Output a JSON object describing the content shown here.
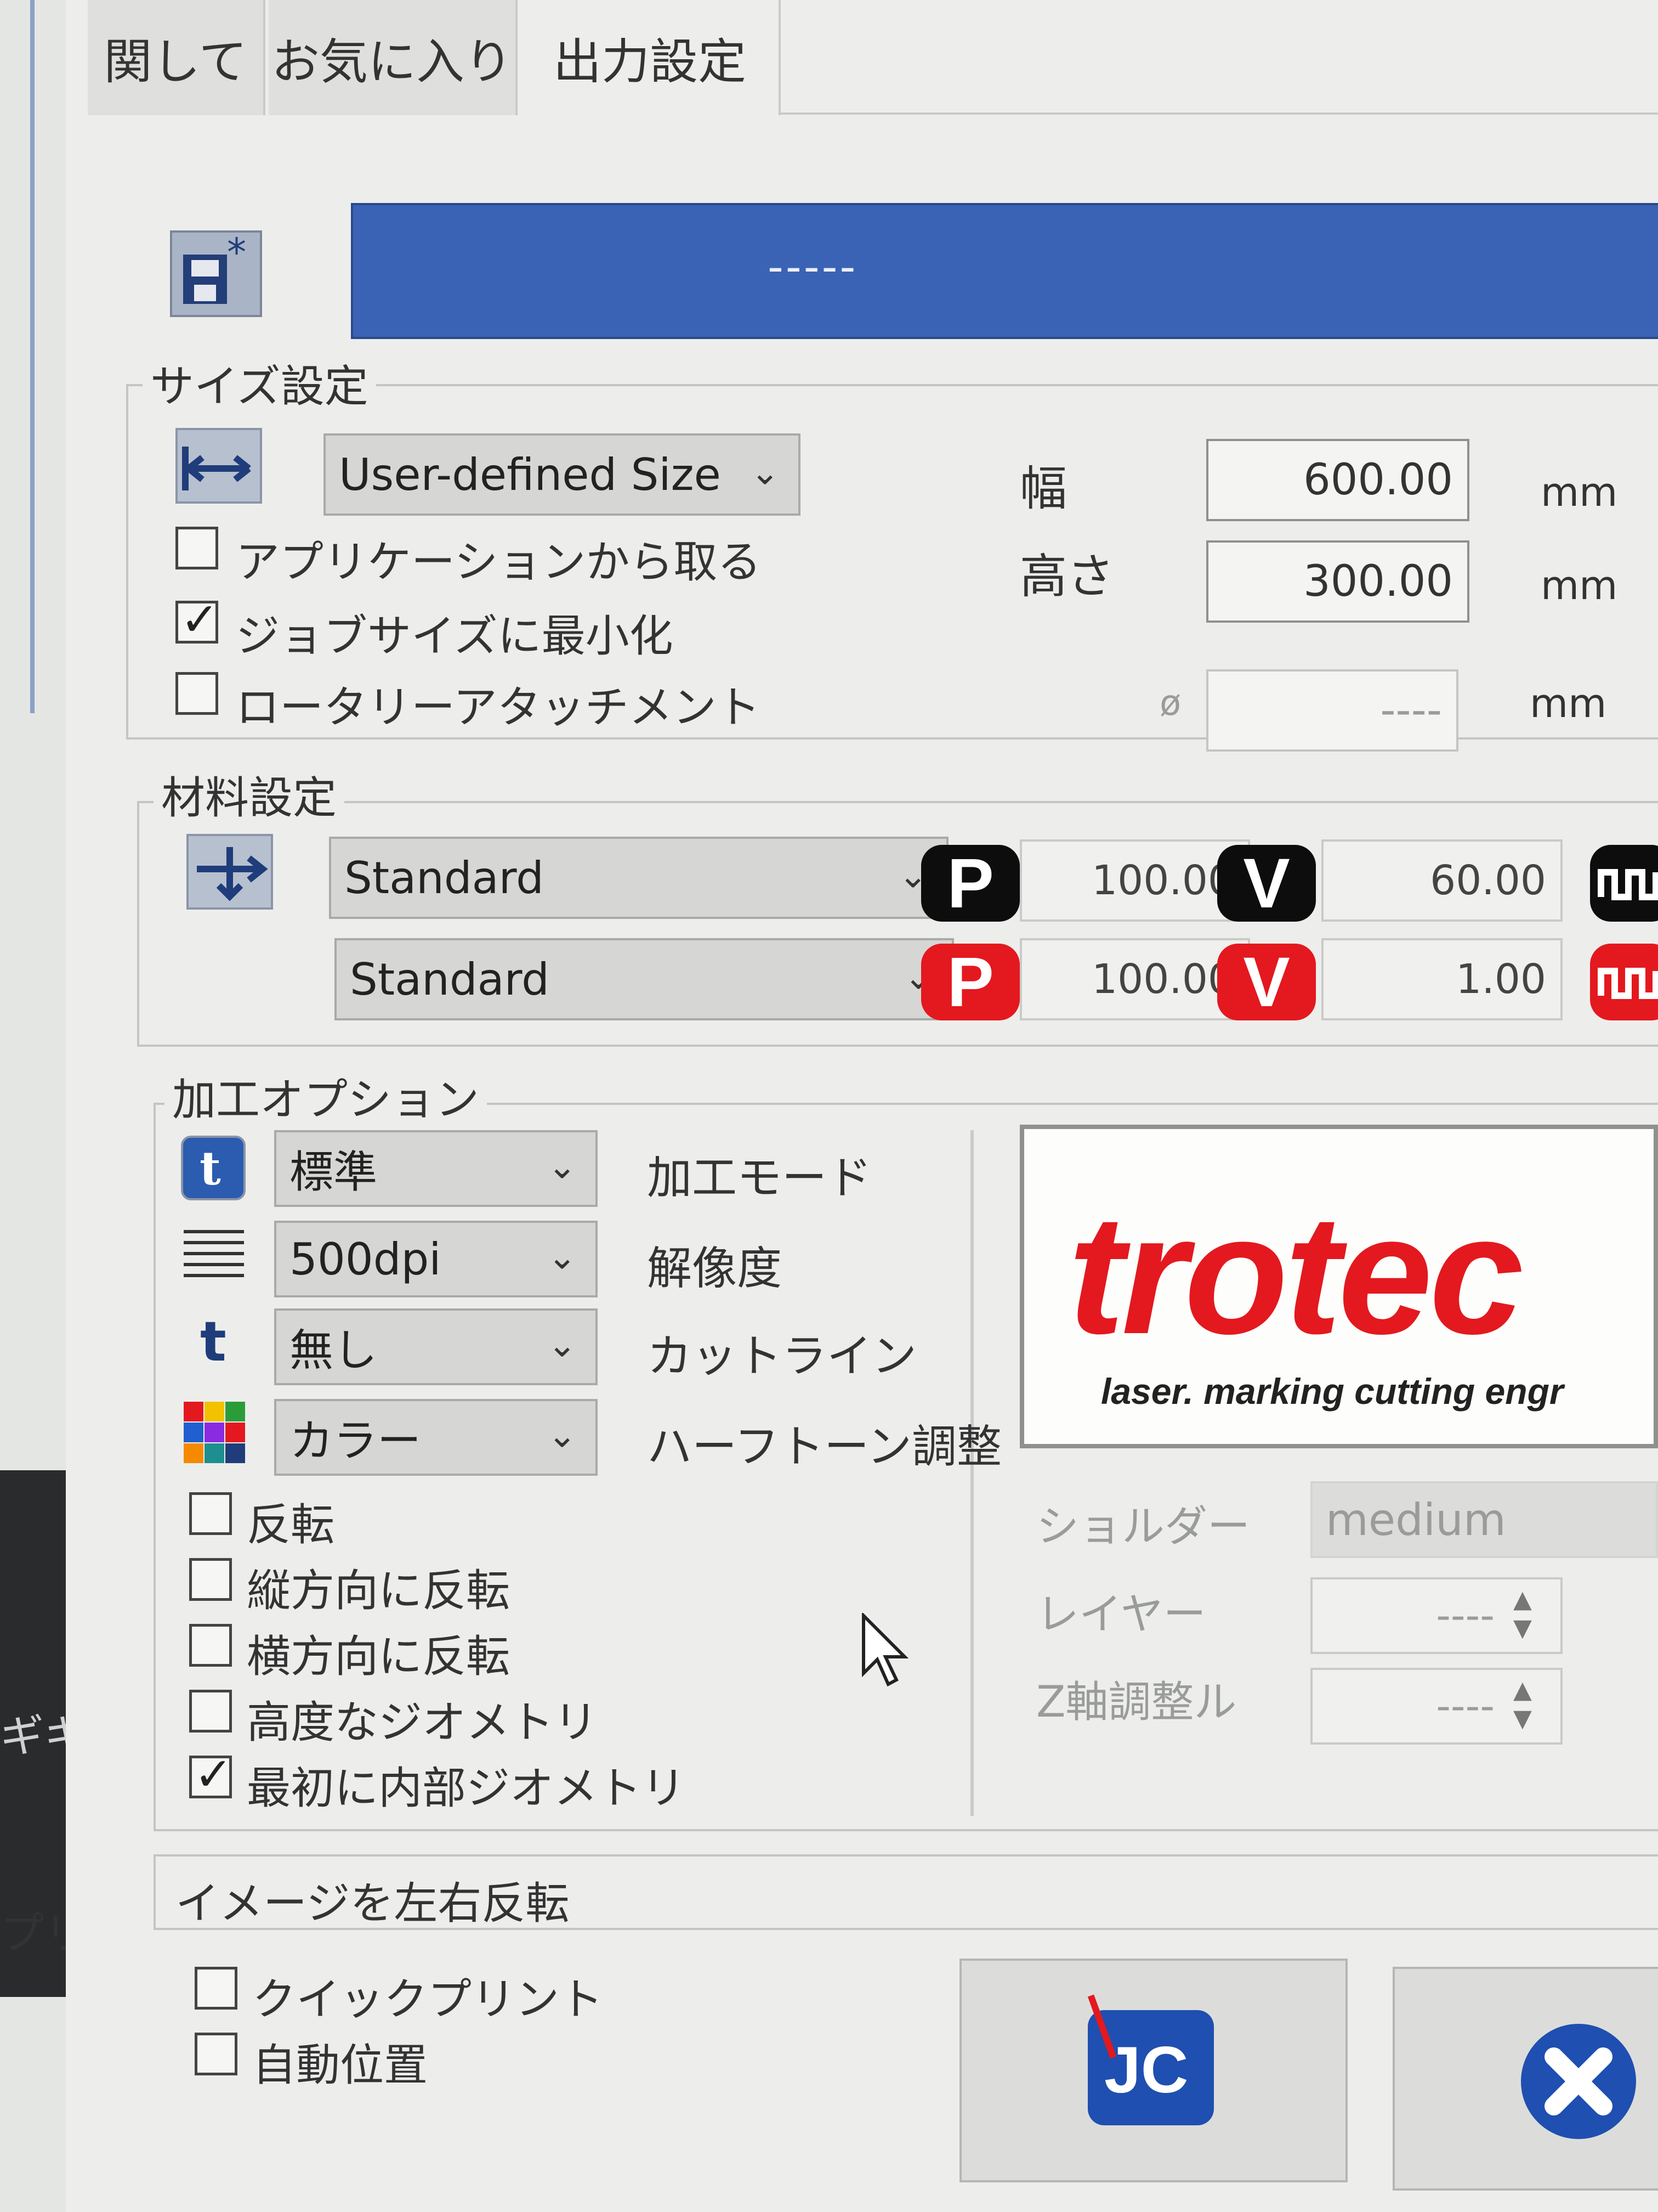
{
  "background_window": {
    "fragment_1": "ギキ",
    "fragment_2": "プリ"
  },
  "tabs": [
    {
      "label": "関して"
    },
    {
      "label": "お気に入り"
    },
    {
      "label": "出力設定"
    }
  ],
  "job_banner": {
    "text": "-----"
  },
  "size_settings": {
    "legend": "サイズ設定",
    "size_dropdown": "User-defined Size",
    "width_label": "幅",
    "width_value": "600.00",
    "width_unit": "mm",
    "height_label": "高さ",
    "height_value": "300.00",
    "height_unit": "mm",
    "diameter_symbol": "ø",
    "diameter_value": "----",
    "diameter_unit": "mm",
    "checkboxes": [
      {
        "label": "アプリケーションから取る",
        "checked": false
      },
      {
        "label": "ジョブサイズに最小化",
        "checked": true
      },
      {
        "label": "ロータリーアタッチメント",
        "checked": false
      }
    ]
  },
  "material_settings": {
    "legend": "材料設定",
    "rows": [
      {
        "material": "Standard",
        "p_label": "P",
        "p_value": "100.00",
        "v_label": "V",
        "v_value": "60.00",
        "color": "black"
      },
      {
        "material": "Standard",
        "p_label": "P",
        "p_value": "100.00",
        "v_label": "V",
        "v_value": "1.00",
        "color": "red"
      }
    ]
  },
  "process_options": {
    "legend": "加工オプション",
    "rows": [
      {
        "value": "標準",
        "label": "加工モード",
        "icon": "process-mode-icon"
      },
      {
        "value": "500dpi",
        "label": "解像度",
        "icon": "resolution-lines-icon"
      },
      {
        "value": "無し",
        "label": "カットライン",
        "icon": "cutline-t-icon"
      },
      {
        "value": "カラー",
        "label": "ハーフトーン調整",
        "icon": "color-grid-icon"
      }
    ],
    "checkboxes": [
      {
        "label": "反転",
        "checked": false
      },
      {
        "label": "縦方向に反転",
        "checked": false
      },
      {
        "label": "横方向に反転",
        "checked": false
      },
      {
        "label": "高度なジオメトリ",
        "checked": false
      },
      {
        "label": "最初に内部ジオメトリ",
        "checked": true
      }
    ],
    "logo": {
      "brand": "trotec",
      "tagline": "laser. marking cutting engr"
    },
    "shoulder_label": "ショルダー",
    "shoulder_value": "medium",
    "layer_label": "レイヤー",
    "layer_value": "----",
    "z_label": "Z軸調整ル",
    "z_value": "----"
  },
  "mirror_section": {
    "label": "イメージを左右反転"
  },
  "bottom_options": [
    {
      "label": "クイックプリント",
      "checked": false
    },
    {
      "label": "自動位置",
      "checked": false
    }
  ],
  "buttons": {
    "job_control": "JC"
  },
  "colors": {
    "banner": "#3a63b5",
    "badge_black": "#0d0d0d",
    "badge_red": "#e3191f",
    "trotec_red": "#e3191f"
  }
}
